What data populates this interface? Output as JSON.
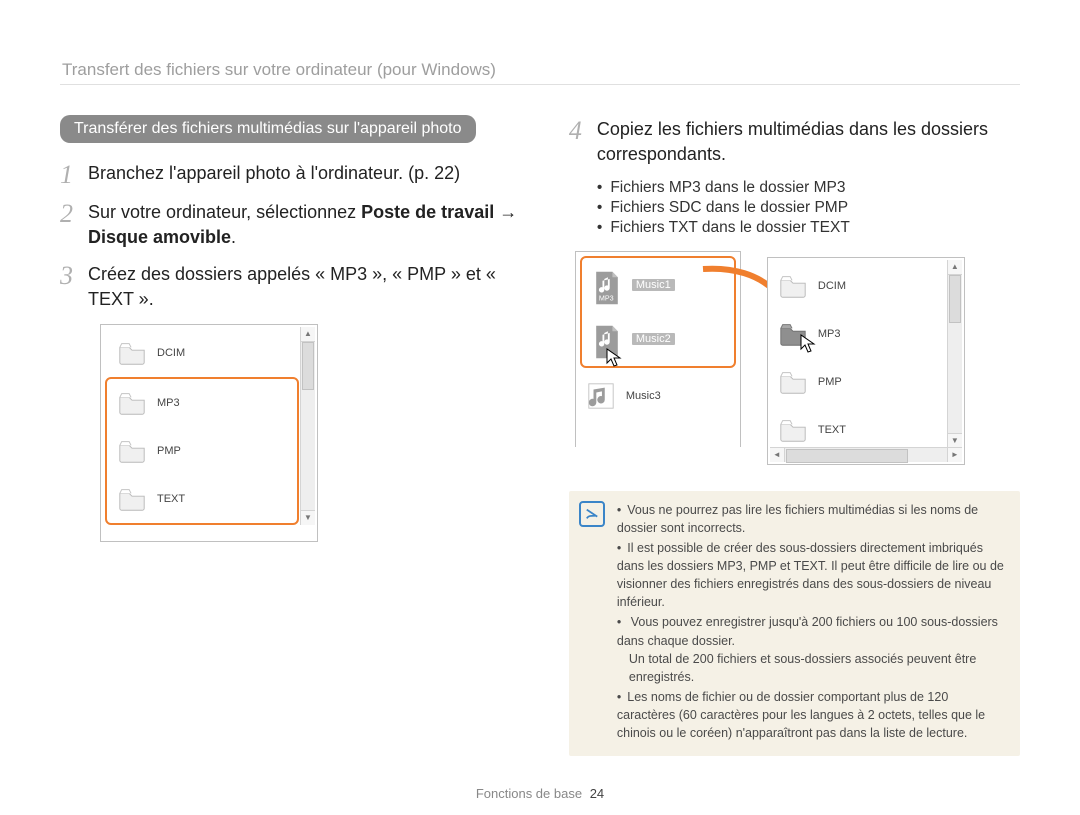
{
  "breadcrumb": "Transfert des fichiers sur votre ordinateur (pour Windows)",
  "pill": "Transférer des fichiers multimédias sur l'appareil photo",
  "steps_left": {
    "s1_num": "1",
    "s1": "Branchez l'appareil photo à l'ordinateur. (p. 22)",
    "s2_num": "2",
    "s2_a": "Sur votre ordinateur, sélectionnez ",
    "s2_b": "Poste de travail",
    "s2_arrow": " → ",
    "s2_c": "Disque amovible",
    "s2_d": ".",
    "s3_num": "3",
    "s3": "Créez des dossiers appelés « MP3 », « PMP » et « TEXT »."
  },
  "left_folders": {
    "f1": "DCIM",
    "f2": "MP3",
    "f3": "PMP",
    "f4": "TEXT"
  },
  "step4_num": "4",
  "step4": "Copiez les fichiers multimédias dans les dossiers correspondants.",
  "sub": {
    "b1": "Fichiers MP3 dans le dossier MP3",
    "b2": "Fichiers SDC dans le dossier PMP",
    "b3": "Fichiers TXT dans le dossier TEXT"
  },
  "win_a": {
    "mp3_badge": "MP3",
    "item1": "Music1",
    "item2": "Music2",
    "item3": "Music3"
  },
  "win_b": {
    "f1": "DCIM",
    "f2": "MP3",
    "f3": "PMP",
    "f4": "TEXT"
  },
  "note": {
    "n1": "Vous ne pourrez pas lire les fichiers multimédias si les noms de dossier sont incorrects.",
    "n2": "Il est possible de créer des sous-dossiers directement imbriqués dans les dossiers MP3, PMP et TEXT. Il peut être difficile de lire ou de visionner des fichiers enregistrés dans des sous-dossiers de niveau inférieur.",
    "n3": "Vous pouvez enregistrer jusqu'à 200 fichiers ou 100 sous-dossiers dans chaque dossier.",
    "n3b": "Un total de 200 fichiers et sous-dossiers associés peuvent être enregistrés.",
    "n4": "Les noms de fichier ou de dossier comportant plus de 120 caractères (60 caractères pour les langues à 2 octets, telles que le chinois ou le coréen) n'apparaîtront pas dans la liste de lecture."
  },
  "footer_label": "Fonctions de base",
  "footer_page": "24"
}
